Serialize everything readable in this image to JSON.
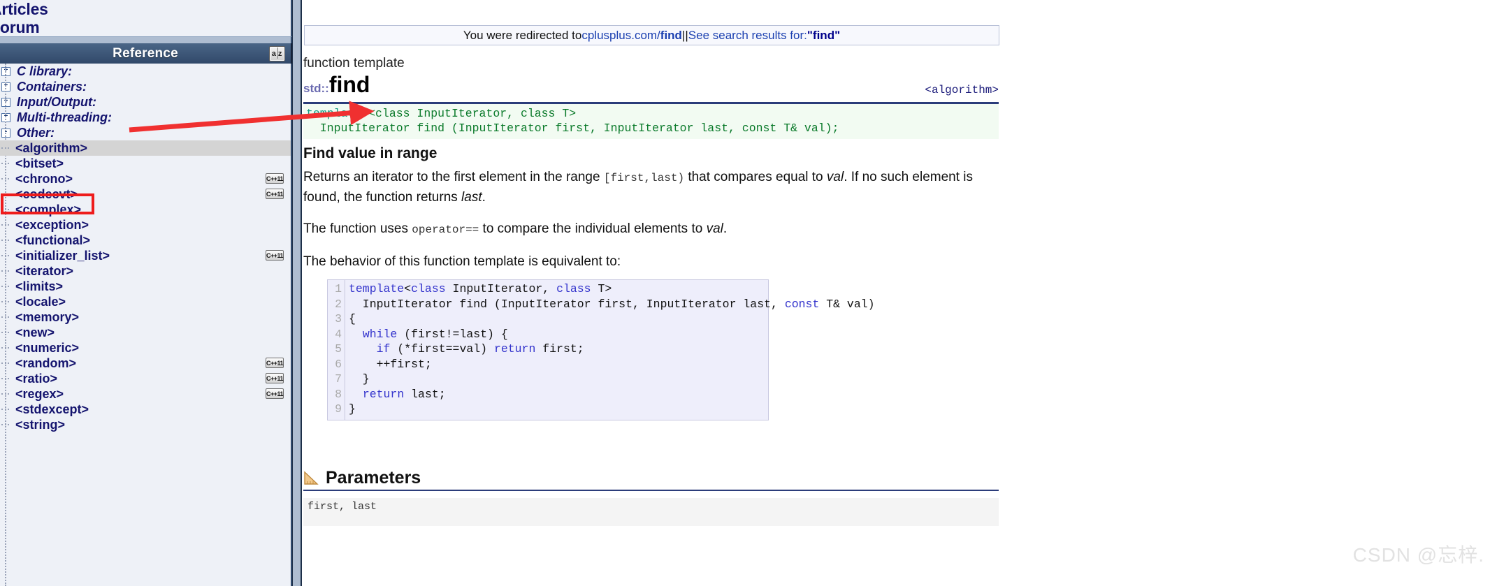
{
  "sidebar": {
    "top_nav": [
      "Articles",
      "Forum"
    ],
    "panel_title": "Reference",
    "az_icon_label": "a|z",
    "groups": [
      {
        "label": "C library:",
        "expander": "+"
      },
      {
        "label": "Containers:",
        "expander": "+"
      },
      {
        "label": "Input/Output:",
        "expander": "+"
      },
      {
        "label": "Multi-threading:",
        "expander": "+"
      },
      {
        "label": "Other:",
        "expander": "-"
      }
    ],
    "items": [
      {
        "label": "<algorithm>",
        "badge": "",
        "selected": true
      },
      {
        "label": "<bitset>",
        "badge": "",
        "selected": false
      },
      {
        "label": "<chrono>",
        "badge": "C++11",
        "selected": false
      },
      {
        "label": "<codecvt>",
        "badge": "C++11",
        "selected": false
      },
      {
        "label": "<complex>",
        "badge": "",
        "selected": false
      },
      {
        "label": "<exception>",
        "badge": "",
        "selected": false
      },
      {
        "label": "<functional>",
        "badge": "",
        "selected": false
      },
      {
        "label": "<initializer_list>",
        "badge": "C++11",
        "selected": false
      },
      {
        "label": "<iterator>",
        "badge": "",
        "selected": false
      },
      {
        "label": "<limits>",
        "badge": "",
        "selected": false
      },
      {
        "label": "<locale>",
        "badge": "",
        "selected": false
      },
      {
        "label": "<memory>",
        "badge": "",
        "selected": false
      },
      {
        "label": "<new>",
        "badge": "",
        "selected": false
      },
      {
        "label": "<numeric>",
        "badge": "",
        "selected": false
      },
      {
        "label": "<random>",
        "badge": "C++11",
        "selected": false
      },
      {
        "label": "<ratio>",
        "badge": "C++11",
        "selected": false
      },
      {
        "label": "<regex>",
        "badge": "C++11",
        "selected": false
      },
      {
        "label": "<stdexcept>",
        "badge": "",
        "selected": false
      },
      {
        "label": "<string>",
        "badge": "",
        "selected": false
      }
    ]
  },
  "banner": {
    "prefix": "You were redirected to ",
    "domain": "cplusplus.com/",
    "domain_bold": "find",
    "separator": " || ",
    "search_text": "See search results for: ",
    "quoted_term": "\"find\""
  },
  "article": {
    "kind": "function template",
    "namespace": "std::",
    "name": "find",
    "header_include": "<algorithm>",
    "signature_line1_kw": "template",
    "signature_line1_rest": " <class InputIterator, class T>",
    "signature_line2": "  InputIterator find (InputIterator first, InputIterator last, const T& val);",
    "section_heading": "Find value in range",
    "para1_a": "Returns an iterator to the first element in the range ",
    "para1_mono": "[first,last)",
    "para1_b": " that compares equal to ",
    "para1_val": "val",
    "para1_c": ". If no such element is found, the function returns ",
    "para1_last": "last",
    "para1_d": ".",
    "para2_a": "The function uses ",
    "para2_mono": "operator==",
    "para2_b": " to compare the individual elements to ",
    "para2_val": "val",
    "para2_c": ".",
    "para3": "The behavior of this function template is equivalent to:",
    "code_lines": [
      "1",
      "2",
      "3",
      "4",
      "5",
      "6",
      "7",
      "8",
      "9"
    ],
    "code": "template<class InputIterator, class T>\n  InputIterator find (InputIterator first, InputIterator last, const T& val)\n{\n  while (first!=last) {\n    if (*first==val) return first;\n    ++first;\n  }\n  return last;\n}",
    "params_title": "Parameters",
    "params_first_line": "first, last"
  },
  "watermark": "CSDN @忘梓.",
  "colors": {
    "accent_link": "#1a3fb0",
    "sidebar_text": "#14146e",
    "panel_header_bg": "#3c5878",
    "annotation_red": "#ee1c1c",
    "selected_row": "#d4d4d4",
    "signature_bg": "#f2fbf2",
    "code_bg": "#eeeefb"
  }
}
